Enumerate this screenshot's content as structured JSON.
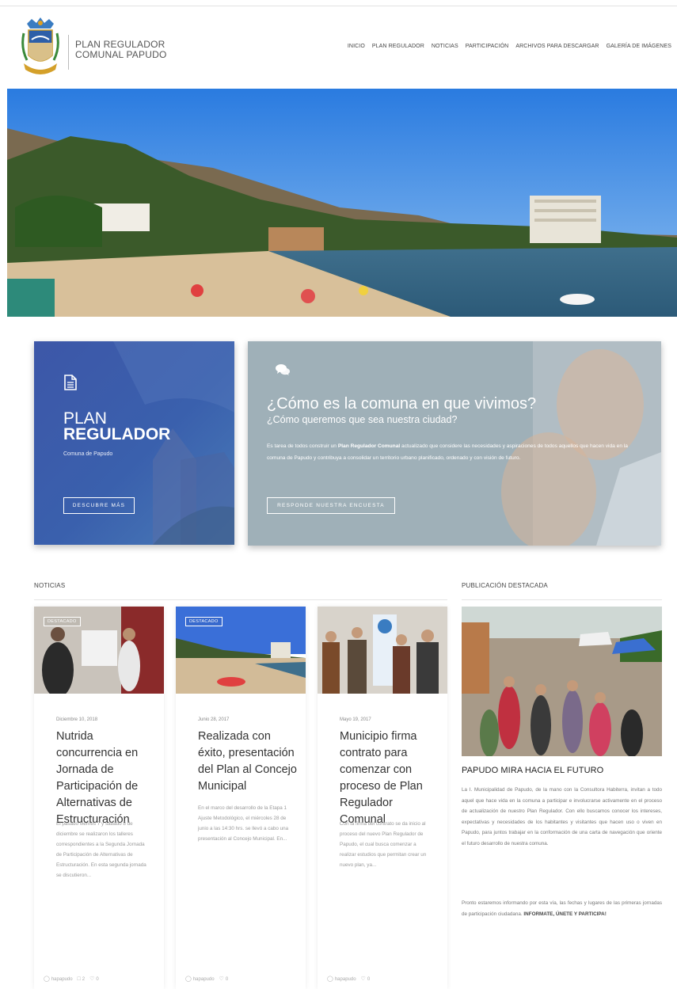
{
  "header": {
    "brand_line1": "PLAN REGULADOR",
    "brand_line2": "COMUNAL PAPUDO",
    "nav": [
      "INICIO",
      "PLAN REGULADOR",
      "NOTICIAS",
      "PARTICIPACIÓN",
      "ARCHIVOS PARA DESCARGAR",
      "GALERÍA DE IMÁGENES"
    ]
  },
  "card_plan": {
    "icon": "document-icon",
    "title_line1": "PLAN",
    "title_line2": "REGULADOR",
    "subtitle": "Comuna de Papudo",
    "button": "DESCUBRE MÁS"
  },
  "card_encuesta": {
    "icon": "chat-bubbles-icon",
    "question": "¿Cómo es la comuna en que vivimos?",
    "question2": "¿Cómo queremos que sea nuestra ciudad?",
    "para_before": "Es tarea de todos construir un ",
    "para_bold": "Plan Regulador Comunal",
    "para_after": " actualizado que considere las necesidades y aspiraciones de todos aquellos que hacen vida en la comuna de Papudo y contribuya a consolidar un territorio urbano planificado, ordenado y con visión de futuro.",
    "button": "RESPONDE NUESTRA ENCUESTA"
  },
  "noticias": {
    "heading": "NOTICIAS",
    "items": [
      {
        "badge": "DESTACADO",
        "date": "Diciembre 10, 2018",
        "title": "Nutrida concurrencia en Jornada de Participación de Alternativas de Estructuración",
        "excerpt": "El pasado viernes 7 y sábado 8 de diciembre se realizaron los talleres correspondientes a la Segunda Jornada de Participación de Alternativas de Estructuración. En esta segunda jornada se discutieron...",
        "author": "hapapudo",
        "comments": "2",
        "likes": "0"
      },
      {
        "badge": "DESTACADO",
        "date": "Junio 28, 2017",
        "title": "Realizada con éxito, presentación del Plan al Concejo Municipal",
        "excerpt": "En el marco del desarrollo de la Etapa 1 Ajuste Metodológico, el miércoles 28 de junio a las 14:30 hrs. se llevó a cabo una presentación al Concejo Municipal. En...",
        "author": "hapapudo",
        "likes": "0"
      },
      {
        "date": "Mayo 19, 2017",
        "title": "Municipio firma contrato para comenzar con proceso de Plan Regulador Comunal",
        "excerpt": "Con la firma del contrato se da inicio al proceso del nuevo Plan Regulador de Papudo, el cual busca comenzar a realizar estudios que permitan crear un nuevo plan, ya...",
        "author": "hapapudo",
        "likes": "0"
      }
    ]
  },
  "destacada": {
    "heading": "PUBLICACIÓN DESTACADA",
    "title": "PAPUDO MIRA HACIA EL FUTURO",
    "body": "La I. Municipalidad de Papudo, de la mano con la Consultora Habiterra, invitan a todo aquel que hace vida en la comuna a participar e involucrarse activamente en el proceso de actualización de nuestro Plan Regulador. Con ello buscamos conocer los intereses, expectativas y necesidades de los habitantes y visitantes que hacen uso o viven en Papudo, para juntos trabajar en la conformación de una carta de navegación que oriente el futuro desarrollo de nuestra comuna.",
    "body2": "Pronto estaremos informando por esta vía, las fechas y lugares de las primeras jornadas de participación ciudadana.",
    "body2_bold": "INFORMATE, ÚNETE Y PARTICIPA!"
  },
  "colors": {
    "blue_card": "#3d57a8",
    "grey_card": "#9aaab2"
  }
}
